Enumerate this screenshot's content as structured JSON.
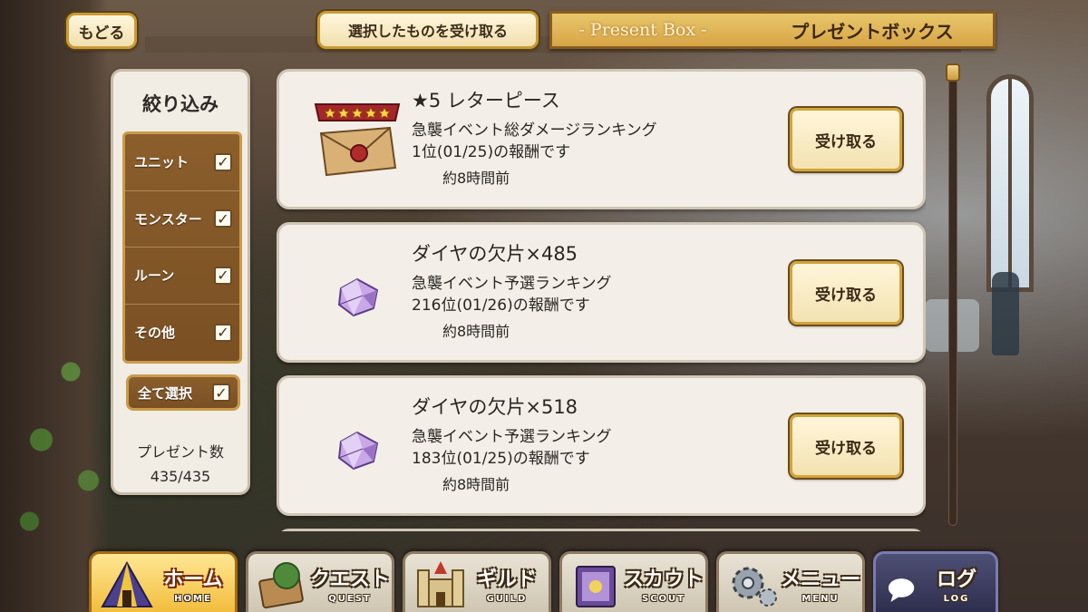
{
  "header": {
    "back_label": "もどる",
    "receive_selected_label": "選択したものを受け取る",
    "title_en": "- Present Box -",
    "title_jp": "プレゼントボックス"
  },
  "filter": {
    "title": "絞り込み",
    "options": [
      {
        "label": "ユニット",
        "checked": true
      },
      {
        "label": "モンスター",
        "checked": true
      },
      {
        "label": "ルーン",
        "checked": true
      },
      {
        "label": "その他",
        "checked": true
      }
    ],
    "select_all_label": "全て選択",
    "check_mark": "✓",
    "count_label": "プレゼント数",
    "count_value": "435/435"
  },
  "presents": [
    {
      "name": "★5 レターピース",
      "desc_line1": "急襲イベント総ダメージランキング",
      "desc_line2": "1位(01/25)の報酬です",
      "time": "約8時間前",
      "icon": "letter-piece-icon",
      "rarity_stars": 5,
      "button_label": "受け取る"
    },
    {
      "name": "ダイヤの欠片×485",
      "desc_line1": "急襲イベント予選ランキング",
      "desc_line2": "216位(01/26)の報酬です",
      "time": "約8時間前",
      "icon": "diamond-shard-icon",
      "button_label": "受け取る"
    },
    {
      "name": "ダイヤの欠片×518",
      "desc_line1": "急襲イベント予選ランキング",
      "desc_line2": "183位(01/25)の報酬です",
      "time": "約8時間前",
      "icon": "diamond-shard-icon",
      "button_label": "受け取る"
    }
  ],
  "nav": [
    {
      "label": "ホーム",
      "sub": "HOME",
      "icon": "home-tent-icon",
      "active": true
    },
    {
      "label": "クエスト",
      "sub": "QUEST",
      "icon": "quest-map-icon",
      "active": false
    },
    {
      "label": "ギルド",
      "sub": "GUILD",
      "icon": "guild-castle-icon",
      "active": false
    },
    {
      "label": "スカウト",
      "sub": "SCOUT",
      "icon": "scout-book-icon",
      "active": false
    },
    {
      "label": "メニュー",
      "sub": "MENU",
      "icon": "menu-gear-icon",
      "active": false
    },
    {
      "label": "ログ",
      "sub": "LOG",
      "icon": "log-chat-icon",
      "active": false
    }
  ],
  "colors": {
    "gold_border": "#c99b34",
    "panel_bg": "#f3efe8",
    "filter_brown": "#8b5e2b",
    "active_nav": "#f2bd3d"
  }
}
